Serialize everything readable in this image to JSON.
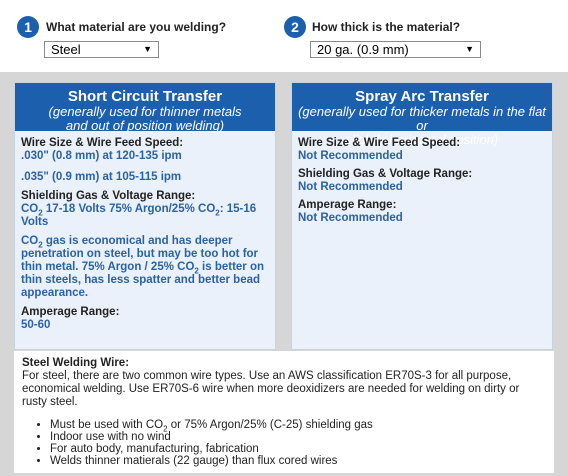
{
  "step1": {
    "number": "1",
    "label": "What material are you welding?",
    "selected": "Steel"
  },
  "step2": {
    "number": "2",
    "label": "How thick is the material?",
    "selected": "20 ga. (0.9 mm)"
  },
  "short_circuit": {
    "title": "Short Circuit Transfer",
    "subtitle_line1": "(generally used for thinner metals",
    "subtitle_line2": "and out of position welding)",
    "wire_label": "Wire Size & Wire Feed Speed:",
    "wire_val1": ".030\" (0.8 mm) at 120-135 ipm",
    "wire_val2": ".035\" (0.9 mm) at 105-115 ipm",
    "gas_label": "Shielding Gas & Voltage Range:",
    "gas_co2_a": "CO",
    "gas_sub": "2",
    "gas_mid": " 17-18 Volts 75% Argon/25% CO",
    "gas_end": ": 15-16",
    "gas_line2": "Volts",
    "note_a": "CO",
    "note_sub": "2",
    "note_b": " gas is economical and has deeper penetration on steel, but may be too hot for thin metal. 75% Argon / 25% CO",
    "note_sub2": "2",
    "note_c": " is better on thin steels, has less spatter and better bead appearance.",
    "amp_label": "Amperage Range:",
    "amp_val": "50-60"
  },
  "spray_arc": {
    "title": "Spray Arc Transfer",
    "subtitle_line1": "(generally used for thicker metals in the flat or",
    "subtitle_line2": "slightly horizontal position)",
    "wire_label": "Wire Size & Wire Feed Speed:",
    "wire_val": "Not Recommended",
    "gas_label": "Shielding Gas & Voltage Range:",
    "gas_val": "Not Recommended",
    "amp_label": "Amperage Range:",
    "amp_val": "Not Recommended"
  },
  "steel_wire": {
    "heading": "Steel Welding Wire:",
    "body": "For steel, there are two common wire types. Use an AWS classification ER70S-3 for all purpose, economical welding. Use ER70S-6 wire when more deoxidizers are needed for welding on dirty or rusty steel.",
    "bullet1_a": "Must be used with CO",
    "bullet1_sub": "2",
    "bullet1_b": " or 75% Argon/25% (C-25) shielding gas",
    "bullet2": "Indoor use with no wind",
    "bullet3": "For auto body, manufacturing, fabrication",
    "bullet4": "Welds thinner matierals (22 gauge) than flux cored wires"
  }
}
